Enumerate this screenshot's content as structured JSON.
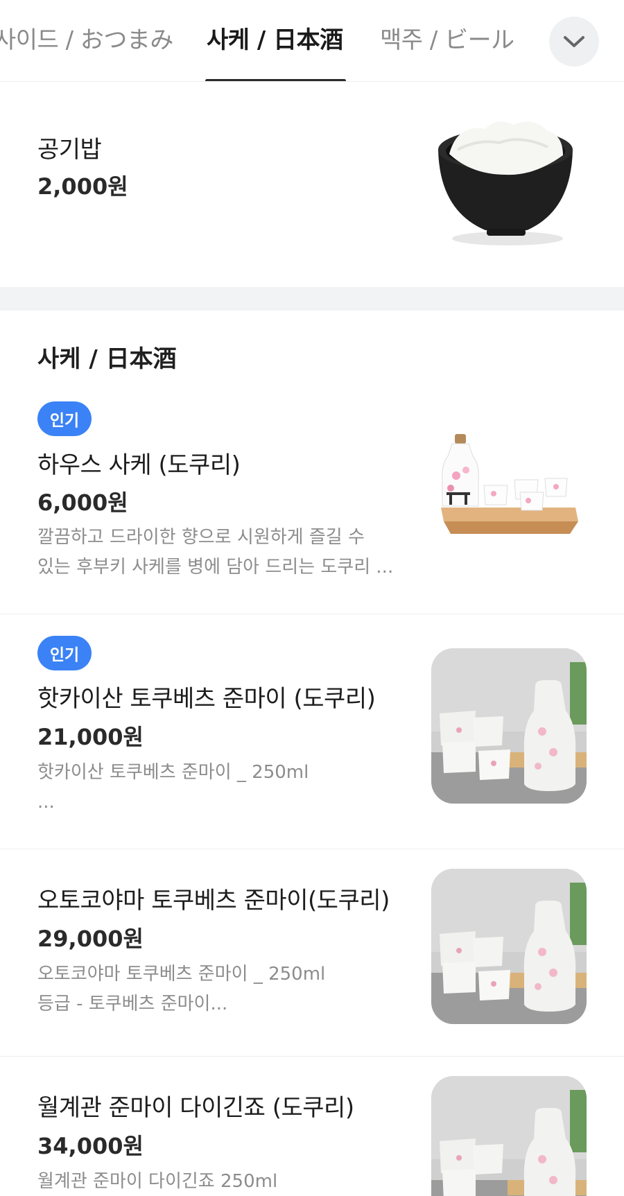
{
  "tabs": [
    {
      "label": "사이드 / おつまみ"
    },
    {
      "label": "사케 / 日本酒"
    },
    {
      "label": "맥주 / ビール"
    }
  ],
  "active_tab": "사케 / 日本酒",
  "icons": {
    "expand": "chevron-down-icon"
  },
  "colors": {
    "badge": "#3b82f6",
    "active_underline": "#2a2a2a",
    "section_gap": "#f2f3f5"
  },
  "prev_item": {
    "name": "공기밥",
    "price": "2,000원"
  },
  "section": {
    "title": "사케 / 日本酒"
  },
  "items": [
    {
      "badge": "인기",
      "name": "하우스 사케 (도쿠리)",
      "price": "6,000원",
      "desc": [
        "깔끔하고 드라이한 향으로 시원하게 즐길 수",
        "있는 후부키 사케를 병에 담아 드리는 도쿠리 ..."
      ]
    },
    {
      "badge": "인기",
      "name": "핫카이산 토쿠베츠 준마이 (도쿠리)",
      "price": "21,000원",
      "desc": [
        "핫카이산 토쿠베츠 준마이 _ 250ml",
        "..."
      ]
    },
    {
      "name": "오토코야마 토쿠베츠 준마이(도쿠리)",
      "price": "29,000원",
      "desc": [
        "오토코야마 토쿠베츠 준마이 _ 250ml",
        "등급 - 토쿠베츠 준마이..."
      ]
    },
    {
      "name": "월계관 준마이 다이긴죠 (도쿠리)",
      "price": "34,000원",
      "desc": [
        "월계관 준마이 다이긴죠 250ml"
      ]
    }
  ]
}
